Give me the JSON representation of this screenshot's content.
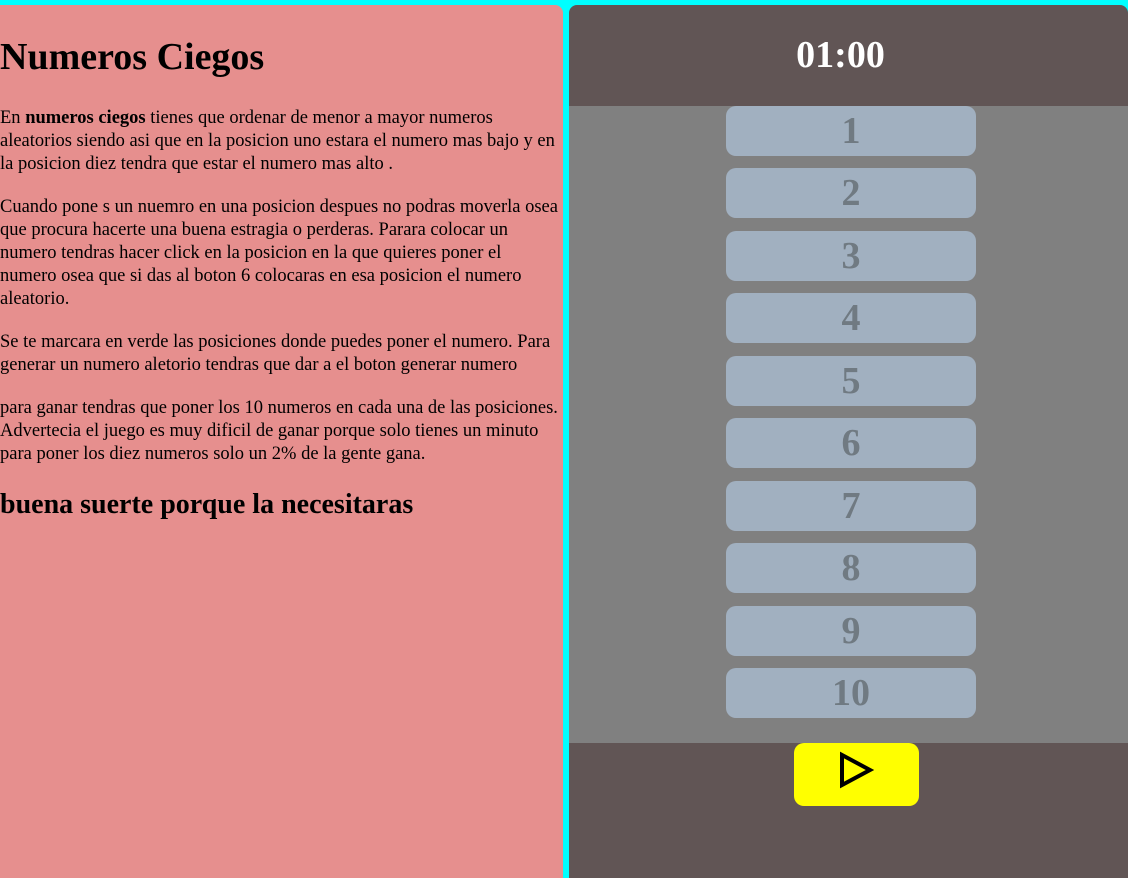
{
  "info": {
    "title": "Numeros Ciegos",
    "p1_bold": "numeros ciegos",
    "p1_before": "En ",
    "p1_after": " tienes que ordenar de menor a mayor numeros aleatorios siendo asi que en la posicion uno estara el numero mas bajo y en la posicion diez tendra que estar el numero mas alto .",
    "p2": "Cuando pone s un nuemro en una posicion despues no podras moverla osea que procura hacerte una buena estragia o perderas. Parara colocar un numero tendras hacer click en la posicion en la que quieres poner el numero osea que si das al boton 6 colocaras en esa posicion el numero aleatorio.",
    "p3": "Se te marcara en verde las posiciones donde puedes poner el numero. Para generar un numero aletorio tendras que dar a el boton generar numero",
    "p4": "para ganar tendras que poner los 10 numeros en cada una de las posiciones. Advertecia el juego es muy dificil de ganar porque solo tienes un minuto para poner los diez numeros solo un 2% de la gente gana.",
    "closing": "buena suerte porque la necesitaras"
  },
  "game": {
    "timer": "01:00",
    "slots": [
      "1",
      "2",
      "3",
      "4",
      "5",
      "6",
      "7",
      "8",
      "9",
      "10"
    ],
    "play_icon": "play-icon"
  },
  "colors": {
    "page_background": "#00ffff",
    "info_panel": "#e68f8e",
    "game_panel": "#615555",
    "slots_area": "#808080",
    "slot": "#a1b0c0",
    "slot_text": "#707a82",
    "play_button": "#ffff00"
  }
}
